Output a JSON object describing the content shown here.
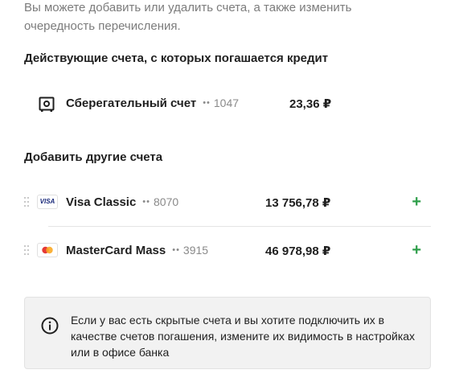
{
  "intro_text": "Вы можете добавить или удалить счета, а также изменить очередность перечисления.",
  "active_section": {
    "title": "Действующие счета, с которых погашается кредит",
    "accounts": [
      {
        "name": "Сберегательный счет",
        "dots": "••",
        "number": "1047",
        "amount": "23,36 ₽",
        "icon": "safe-icon"
      }
    ]
  },
  "add_section": {
    "title": "Добавить другие счета",
    "accounts": [
      {
        "name": "Visa Classic",
        "dots": "••",
        "number": "8070",
        "amount": "13 756,78 ₽",
        "icon": "visa-card-icon",
        "card_label": "VISA",
        "action": "+"
      },
      {
        "name": "MasterCard Mass",
        "dots": "••",
        "number": "3915",
        "amount": "46 978,98 ₽",
        "icon": "mastercard-icon",
        "action": "+"
      }
    ]
  },
  "info_box": {
    "text": "Если у вас есть скрытые счета и вы хотите подключить их в качестве счетов погашения, измените их видимость в настройках или в офисе банка",
    "icon": "info-icon"
  },
  "colors": {
    "accent_plus": "#2e9e4a",
    "muted": "#7c7c7c",
    "info_bg": "#f2f2f2"
  }
}
